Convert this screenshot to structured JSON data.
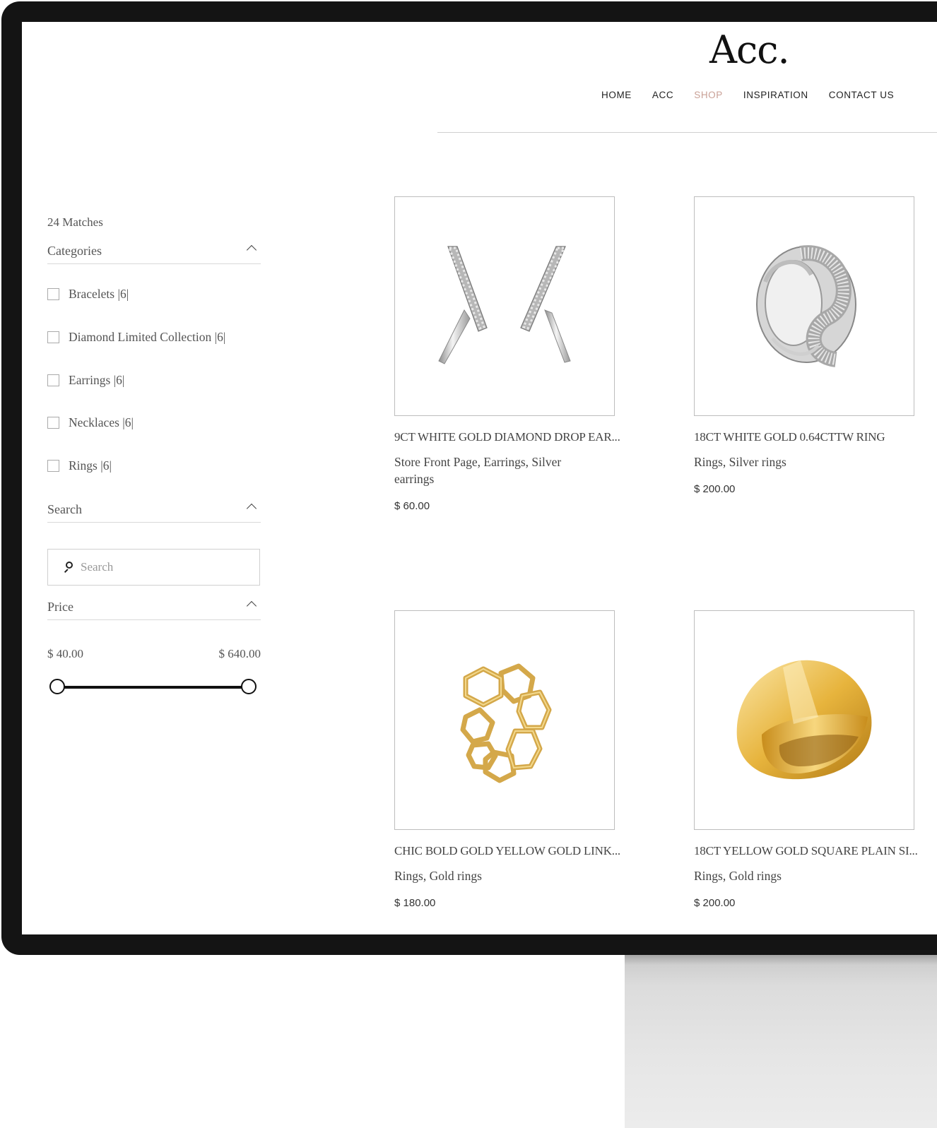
{
  "header": {
    "logo": "Acc.",
    "nav": [
      "HOME",
      "ACC",
      "SHOP",
      "INSPIRATION",
      "CONTACT US"
    ],
    "active_nav": "SHOP",
    "accent_color": "#c9a096"
  },
  "sidebar": {
    "matches": "24 Matches",
    "categories_title": "Categories",
    "categories": [
      {
        "label": "Bracelets |6|"
      },
      {
        "label": "Diamond Limited Collection |6|"
      },
      {
        "label": "Earrings |6|"
      },
      {
        "label": "Necklaces |6|"
      },
      {
        "label": "Rings |6|"
      }
    ],
    "search_title": "Search",
    "search_placeholder": "Search",
    "price_title": "Price",
    "price_min": "$ 40.00",
    "price_max": "$ 640.00"
  },
  "products": [
    {
      "name": "9CT WHITE GOLD DIAMOND DROP EAR...",
      "categories": "Store Front Page, Earrings, Silver earrings",
      "price": "$ 60.00",
      "image_icon": "silver-drop-earrings-icon"
    },
    {
      "name": "18CT WHITE GOLD 0.64CTTW RING",
      "categories": "Rings, Silver rings",
      "price": "$ 200.00",
      "image_icon": "white-gold-diamond-ring-icon"
    },
    {
      "name": "CHIC BOLD GOLD YELLOW GOLD LINK...",
      "categories": "Rings, Gold rings",
      "price": "$ 180.00",
      "image_icon": "gold-link-ring-icon"
    },
    {
      "name": "18CT YELLOW GOLD SQUARE PLAIN SI...",
      "categories": "Rings, Gold rings",
      "price": "$ 200.00",
      "image_icon": "gold-signet-ring-icon"
    }
  ]
}
